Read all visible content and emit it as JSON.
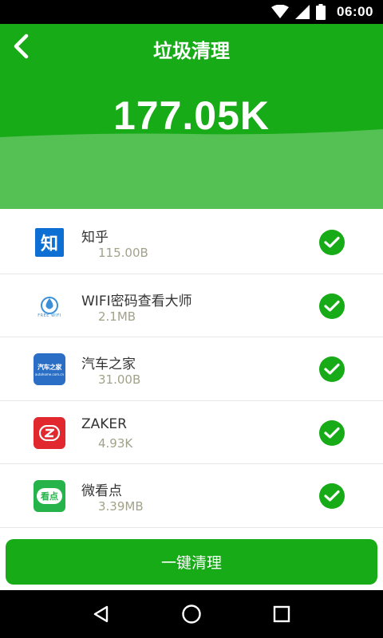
{
  "status_bar": {
    "time": "06:00"
  },
  "header": {
    "title": "垃圾清理",
    "total_size": "177.05K"
  },
  "apps": [
    {
      "name": "知乎",
      "size": "115.00B",
      "icon": "zhihu-icon",
      "icon_text": "知",
      "checked": true
    },
    {
      "name": "WIFI密码查看大师",
      "size": "2.1MB",
      "icon": "wifi-master-icon",
      "icon_text": "FREE WIFI",
      "checked": true
    },
    {
      "name": "汽车之家",
      "size": "31.00B",
      "icon": "autohome-icon",
      "icon_text": "汽车之家",
      "icon_subtext": "autohome.com.cn",
      "checked": true
    },
    {
      "name": "ZAKER",
      "size": "4.93K",
      "icon": "zaker-icon",
      "checked": true
    },
    {
      "name": "微看点",
      "size": "3.39MB",
      "icon": "kandian-icon",
      "icon_text": "看点",
      "checked": true
    }
  ],
  "actions": {
    "clean_label": "一键清理"
  },
  "colors": {
    "primary": "#17ab17",
    "wave": "#55c155",
    "size_text": "#a2a28b"
  }
}
